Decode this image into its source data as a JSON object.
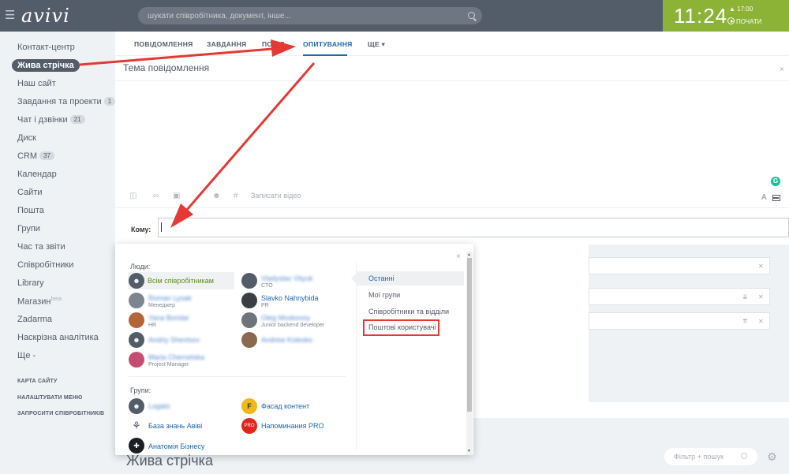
{
  "header": {
    "logo": "avivi",
    "search_placeholder": "шукати співробітника, документ, інше...",
    "clock": "11:24",
    "alarm": "▲ 17:00",
    "start": "ПОЧАТИ"
  },
  "sidebar": {
    "items": [
      {
        "label": "Контакт-центр"
      },
      {
        "label": "Жива стрічка",
        "active": true
      },
      {
        "label": "Наш сайт"
      },
      {
        "label": "Завдання та проекти",
        "count": "1"
      },
      {
        "label": "Чат і дзвінки",
        "count": "21"
      },
      {
        "label": "Диск"
      },
      {
        "label": "CRM",
        "count": "37"
      },
      {
        "label": "Календар"
      },
      {
        "label": "Сайти"
      },
      {
        "label": "Пошта"
      },
      {
        "label": "Групи"
      },
      {
        "label": "Час та звіти"
      },
      {
        "label": "Співробітники"
      },
      {
        "label": "Library"
      },
      {
        "label": "Магазин",
        "sup": "beta"
      },
      {
        "label": "Zadarma"
      },
      {
        "label": "Наскрізна аналітика"
      },
      {
        "label": "Ще -"
      }
    ],
    "links": [
      "КАРТА САЙТУ",
      "НАЛАШТУВАТИ МЕНЮ",
      "ЗАПРОСИТИ СПІВРОБІТНИКІВ"
    ]
  },
  "composer": {
    "tabs": [
      "ПОВІДОМЛЕННЯ",
      "ЗАВДАННЯ",
      "ПОДІЯ",
      "ОПИТУВАННЯ",
      "ЩЕ ▾"
    ],
    "active_tab": "ОПИТУВАННЯ",
    "subject_placeholder": "Тема повідомлення",
    "record_video": "Записати відео",
    "to_label": "Кому:",
    "format_a": "A"
  },
  "popup": {
    "people_label": "Люди:",
    "groups_label": "Групи:",
    "people": [
      {
        "name": "Всім співробітникам",
        "position": "",
        "selected": true
      },
      {
        "name": "Vladyslav Vityuk",
        "position": "CTO",
        "blur": true
      },
      {
        "name": "Roman Lysak",
        "position": "Менеджер",
        "blur": true
      },
      {
        "name": "Slavko Nahnybida",
        "position": "PR"
      },
      {
        "name": "Yana Bondar",
        "position": "HR",
        "blur": true
      },
      {
        "name": "Oleg Moskovoy",
        "position": "Junior backend developer",
        "blur": true
      },
      {
        "name": "Andriy Shevtsov",
        "position": "",
        "blur": true
      },
      {
        "name": "Andrew Kolesko",
        "position": "",
        "blur": true
      },
      {
        "name": "Maria Chernetska",
        "position": "Project Manager",
        "blur": true
      }
    ],
    "groups": [
      {
        "name": "Logato",
        "blur": true
      },
      {
        "name": "Фасад контент",
        "icon": "F"
      },
      {
        "name": "База знань Авіві"
      },
      {
        "name": "Напоминания PRO",
        "icon": "PRO"
      },
      {
        "name": "Анатомія Бізнесу"
      }
    ],
    "right_tabs": [
      "Останні",
      "Мої групи",
      "Співробітники та відділи",
      "Поштові користувачі"
    ]
  },
  "feed": {
    "title": "Жива стрічка",
    "filter_placeholder": "Фільтр + пошук"
  },
  "colors": {
    "header": "#535c69",
    "clock_bg": "#8cb236",
    "link": "#2067b0",
    "annotation": "#e53935"
  }
}
